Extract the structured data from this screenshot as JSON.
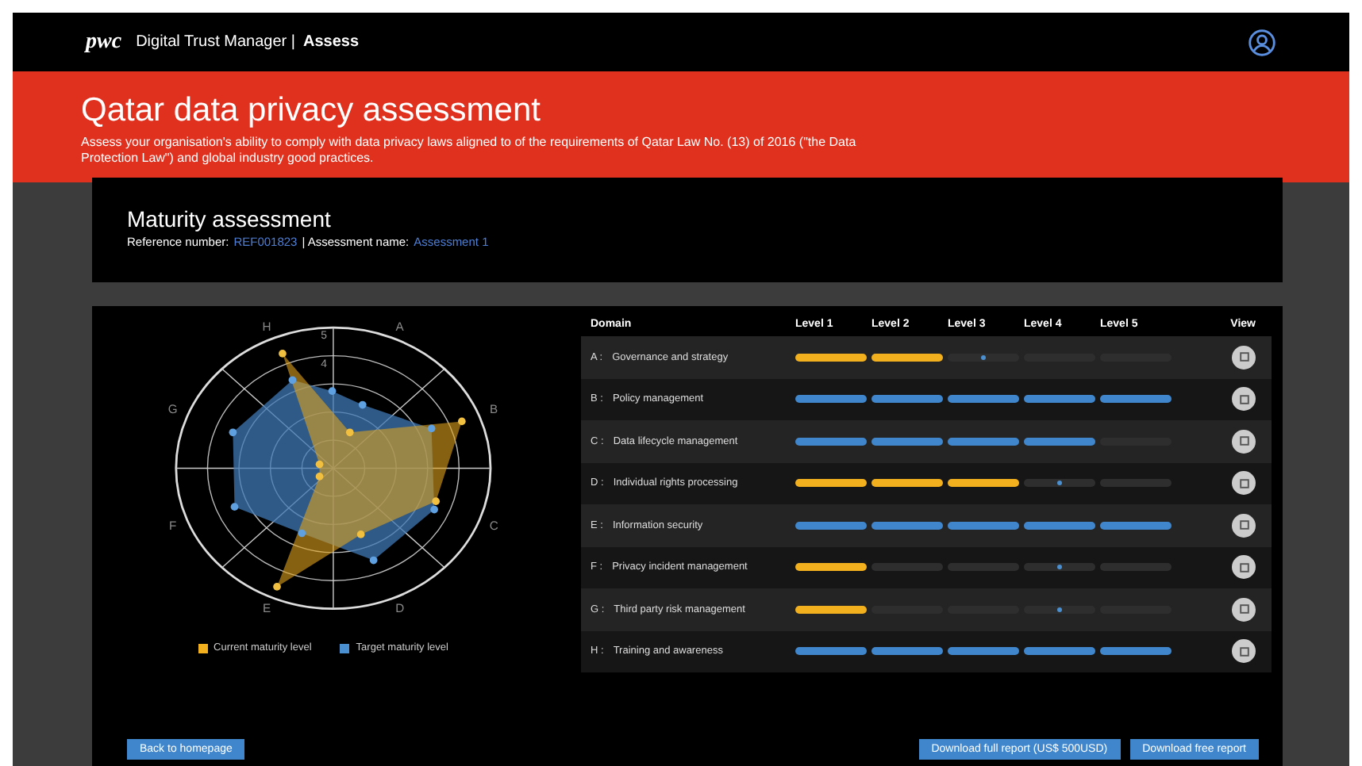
{
  "header": {
    "brand": "pwc",
    "app_name": "Digital Trust Manager |",
    "section": "Assess"
  },
  "hero": {
    "title": "Qatar data privacy assessment",
    "description": "Assess your organisation's ability to comply with data privacy laws aligned to of the requirements of Qatar Law No. (13) of 2016 (\"the Data Protection Law\") and global industry good practices."
  },
  "assessment": {
    "title": "Maturity assessment",
    "reference_label": "Reference number:",
    "reference": "REF001823",
    "name_label": "| Assessment name:",
    "name": "Assessment 1"
  },
  "radar": {
    "axes": [
      "A",
      "B",
      "C",
      "D",
      "E",
      "F",
      "G",
      "H"
    ],
    "ring_labels": [
      "5",
      "4"
    ]
  },
  "legend": [
    {
      "label": "Current maturity level",
      "color": "#f2b01e"
    },
    {
      "label": "Target maturity level",
      "color": "#4a8fd0"
    }
  ],
  "table": {
    "columns": [
      "Domain",
      "Level 1",
      "Level 2",
      "Level 3",
      "Level 4",
      "Level 5",
      "View"
    ],
    "rows": [
      {
        "letter": "A :",
        "name": "Governance and strategy",
        "cells": [
          {
            "kind": "current",
            "marker": false
          },
          {
            "kind": "current",
            "marker": false
          },
          {
            "kind": "empty",
            "marker": true
          },
          {
            "kind": "empty",
            "marker": false
          },
          {
            "kind": "empty",
            "marker": false
          }
        ]
      },
      {
        "letter": "B :",
        "name": "Policy management",
        "cells": [
          {
            "kind": "target",
            "marker": false
          },
          {
            "kind": "target",
            "marker": false
          },
          {
            "kind": "target",
            "marker": false
          },
          {
            "kind": "target",
            "marker": false
          },
          {
            "kind": "target",
            "marker": false
          }
        ]
      },
      {
        "letter": "C :",
        "name": "Data lifecycle management",
        "cells": [
          {
            "kind": "target",
            "marker": false
          },
          {
            "kind": "target",
            "marker": false
          },
          {
            "kind": "target",
            "marker": false
          },
          {
            "kind": "target",
            "marker": false
          },
          {
            "kind": "empty",
            "marker": false
          }
        ]
      },
      {
        "letter": "D :",
        "name": "Individual rights processing",
        "cells": [
          {
            "kind": "current",
            "marker": false
          },
          {
            "kind": "current",
            "marker": false
          },
          {
            "kind": "current",
            "marker": false
          },
          {
            "kind": "empty",
            "marker": true
          },
          {
            "kind": "empty",
            "marker": false
          }
        ]
      },
      {
        "letter": "E :",
        "name": "Information security",
        "cells": [
          {
            "kind": "target",
            "marker": false
          },
          {
            "kind": "target",
            "marker": false
          },
          {
            "kind": "target",
            "marker": false
          },
          {
            "kind": "target",
            "marker": false
          },
          {
            "kind": "target",
            "marker": false
          }
        ]
      },
      {
        "letter": "F :",
        "name": "Privacy incident management",
        "cells": [
          {
            "kind": "current",
            "marker": false
          },
          {
            "kind": "empty",
            "marker": false
          },
          {
            "kind": "empty",
            "marker": false
          },
          {
            "kind": "empty",
            "marker": true
          },
          {
            "kind": "empty",
            "marker": false
          }
        ]
      },
      {
        "letter": "G :",
        "name": "Third party risk management",
        "cells": [
          {
            "kind": "current",
            "marker": false
          },
          {
            "kind": "empty",
            "marker": false
          },
          {
            "kind": "empty",
            "marker": false
          },
          {
            "kind": "empty",
            "marker": true
          },
          {
            "kind": "empty",
            "marker": false
          }
        ]
      },
      {
        "letter": "H :",
        "name": "Training and awareness",
        "cells": [
          {
            "kind": "target",
            "marker": false
          },
          {
            "kind": "target",
            "marker": false
          },
          {
            "kind": "target",
            "marker": false
          },
          {
            "kind": "target",
            "marker": false
          },
          {
            "kind": "target",
            "marker": false
          }
        ]
      }
    ]
  },
  "buttons": {
    "left": [
      "Back to homepage"
    ],
    "right": [
      "Download full report (US$ 500USD)",
      "Download free report"
    ]
  }
}
